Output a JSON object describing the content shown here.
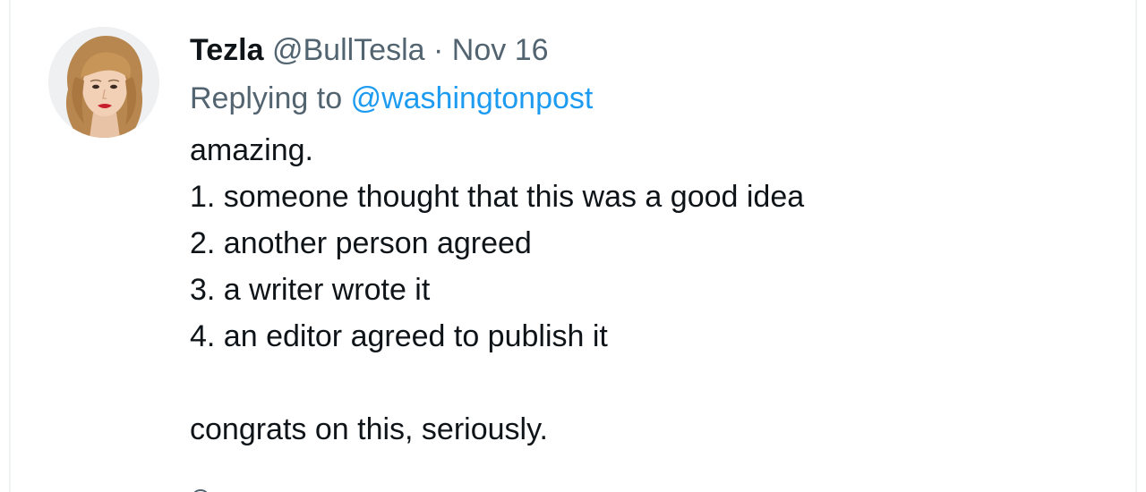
{
  "tweet": {
    "author": {
      "display_name": "Tezla",
      "handle": "@BullTesla"
    },
    "separator": "·",
    "date": "Nov 16",
    "reply": {
      "prefix": "Replying to",
      "handle": "@washingtonpost"
    },
    "text_lines": [
      "amazing.",
      "1. someone thought that this was a good idea",
      "2. another person agreed",
      "3. a writer wrote it",
      "4. an editor agreed to publish it",
      "",
      "congrats on this, seriously."
    ]
  },
  "colors": {
    "text_primary": "#0f1419",
    "text_secondary": "#536471",
    "link": "#1d9bf0"
  },
  "icons": {
    "avatar": "profile-photo",
    "partial_action": "reply-icon"
  }
}
